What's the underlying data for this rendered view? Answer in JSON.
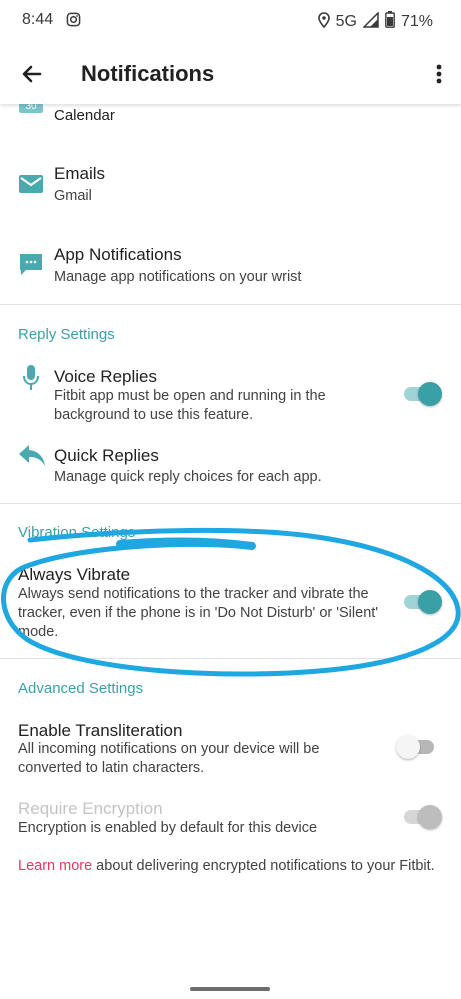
{
  "status_bar": {
    "time": "8:44",
    "network": "5G",
    "battery": "71%"
  },
  "app_bar": {
    "title": "Notifications"
  },
  "items": {
    "calendar": {
      "title": "Calendar"
    },
    "emails": {
      "title": "Emails",
      "subtitle": "Gmail"
    },
    "app_notifications": {
      "title": "App Notifications",
      "subtitle": "Manage app notifications on your wrist"
    }
  },
  "reply_settings": {
    "header": "Reply Settings",
    "voice_replies": {
      "title": "Voice Replies",
      "subtitle": "Fitbit app must be open and running in the background to use this feature.",
      "enabled": true
    },
    "quick_replies": {
      "title": "Quick Replies",
      "subtitle": "Manage quick reply choices for each app."
    }
  },
  "vibration_settings": {
    "header": "Vibration Settings",
    "always_vibrate": {
      "title": "Always Vibrate",
      "subtitle": "Always send notifications to the tracker and vibrate the tracker, even if the phone is in 'Do Not Disturb' or 'Silent' mode.",
      "enabled": true
    }
  },
  "advanced_settings": {
    "header": "Advanced Settings",
    "enable_transliteration": {
      "title": "Enable Transliteration",
      "subtitle": "All incoming notifications on your device will be converted to latin characters.",
      "enabled": false
    },
    "require_encryption": {
      "title": "Require Encryption",
      "subtitle": "Encryption is enabled by default for this device",
      "enabled": true,
      "disabled": true
    }
  },
  "footer": {
    "link": "Learn more",
    "text": " about delivering encrypted notifications to your Fitbit."
  },
  "colors": {
    "accent": "#3aa0a8",
    "link": "#e8365f",
    "annotation": "#1ea7e1"
  },
  "icons": [
    "instagram-icon",
    "location-icon",
    "signal-icon",
    "battery-icon",
    "back-arrow-icon",
    "more-vert-icon",
    "calendar-icon",
    "email-icon",
    "chat-bubble-icon",
    "microphone-icon",
    "reply-icon"
  ]
}
